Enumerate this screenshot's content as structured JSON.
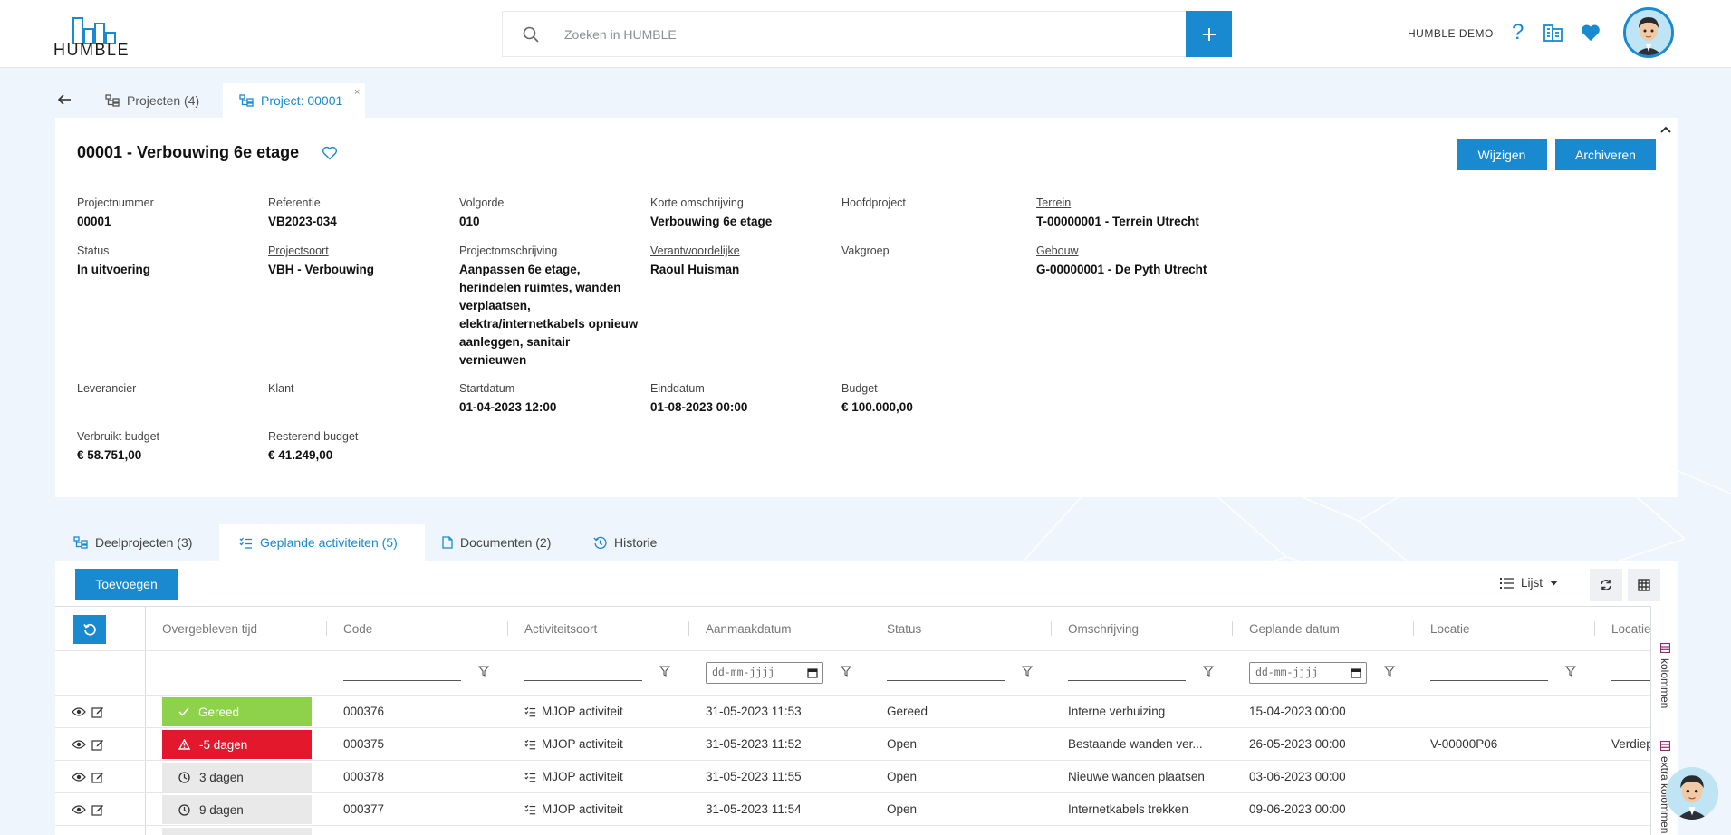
{
  "app": {
    "logo_text": "HUMBLE",
    "search_placeholder": "Zoeken in HUMBLE",
    "add_label": "+",
    "user_name": "HUMBLE DEMO",
    "help_label": "?",
    "accent": "#1a8ad0"
  },
  "tabs": {
    "projects_label": "Projecten (4)",
    "project_label": "Project: 00001",
    "close_label": "×"
  },
  "detail": {
    "title": "00001 - Verbouwing 6e etage",
    "edit_button": "Wijzigen",
    "archive_button": "Archiveren",
    "fields": {
      "projectnummer": {
        "label": "Projectnummer",
        "value": "00001"
      },
      "referentie": {
        "label": "Referentie",
        "value": "VB2023-034"
      },
      "volgorde": {
        "label": "Volgorde",
        "value": "010"
      },
      "korte_omschrijving": {
        "label": "Korte omschrijving",
        "value": "Verbouwing 6e etage"
      },
      "hoofdproject": {
        "label": "Hoofdproject",
        "value": ""
      },
      "terrein": {
        "label": "Terrein",
        "value": "T-00000001 - Terrein Utrecht"
      },
      "status": {
        "label": "Status",
        "value": "In uitvoering"
      },
      "projectsoort": {
        "label": "Projectsoort",
        "value": "VBH - Verbouwing"
      },
      "projectomschrijving": {
        "label": "Projectomschrijving",
        "value": "Aanpassen 6e etage, herindelen ruimtes, wanden verplaatsen, elektra/internetkabels opnieuw aanleggen, sanitair vernieuwen"
      },
      "verantwoordelijke": {
        "label": "Verantwoordelijke",
        "value": "Raoul Huisman"
      },
      "vakgroep": {
        "label": "Vakgroep",
        "value": ""
      },
      "gebouw": {
        "label": "Gebouw",
        "value": "G-00000001 - De Pyth Utrecht"
      },
      "leverancier": {
        "label": "Leverancier",
        "value": ""
      },
      "klant": {
        "label": "Klant",
        "value": ""
      },
      "startdatum": {
        "label": "Startdatum",
        "value": "01-04-2023 12:00"
      },
      "einddatum": {
        "label": "Einddatum",
        "value": "01-08-2023 00:00"
      },
      "budget": {
        "label": "Budget",
        "value": "€ 100.000,00"
      },
      "verbruikt_budget": {
        "label": "Verbruikt budget",
        "value": "€ 58.751,00"
      },
      "resterend_budget": {
        "label": "Resterend budget",
        "value": "€ 41.249,00"
      }
    }
  },
  "subtabs": {
    "deelprojecten": "Deelprojecten (3)",
    "geplande": "Geplande activiteiten (5)",
    "documenten": "Documenten (2)",
    "historie": "Historie"
  },
  "table": {
    "add_button": "Toevoegen",
    "view_label": "Lijst",
    "date_placeholder": "dd-mm-jjjj",
    "columns": [
      "Overgebleven tijd",
      "Code",
      "Activiteitsoort",
      "Aanmaakdatum",
      "Status",
      "Omschrijving",
      "Geplande datum",
      "Locatie",
      "Locatie"
    ],
    "rows": [
      {
        "remaining": "Gereed",
        "remaining_state": "done",
        "code": "000376",
        "soort": "MJOP activiteit",
        "aanmaak": "31-05-2023 11:53",
        "status": "Gereed",
        "omschrijving": "Interne verhuizing",
        "gepland": "15-04-2023 00:00",
        "locatie": "",
        "locatie2": ""
      },
      {
        "remaining": "-5 dagen",
        "remaining_state": "overdue",
        "code": "000375",
        "soort": "MJOP activiteit",
        "aanmaak": "31-05-2023 11:52",
        "status": "Open",
        "omschrijving": "Bestaande wanden ver...",
        "gepland": "26-05-2023 00:00",
        "locatie": "V-00000P06",
        "locatie2": "Verdiep"
      },
      {
        "remaining": "3 dagen",
        "remaining_state": "pending",
        "code": "000378",
        "soort": "MJOP activiteit",
        "aanmaak": "31-05-2023 11:55",
        "status": "Open",
        "omschrijving": "Nieuwe wanden plaatsen",
        "gepland": "03-06-2023 00:00",
        "locatie": "",
        "locatie2": ""
      },
      {
        "remaining": "9 dagen",
        "remaining_state": "pending",
        "code": "000377",
        "soort": "MJOP activiteit",
        "aanmaak": "31-05-2023 11:54",
        "status": "Open",
        "omschrijving": "Internetkabels trekken",
        "gepland": "09-06-2023 00:00",
        "locatie": "",
        "locatie2": ""
      }
    ],
    "rail_columns": "kolommen",
    "rail_extra": "extra kolommen"
  }
}
